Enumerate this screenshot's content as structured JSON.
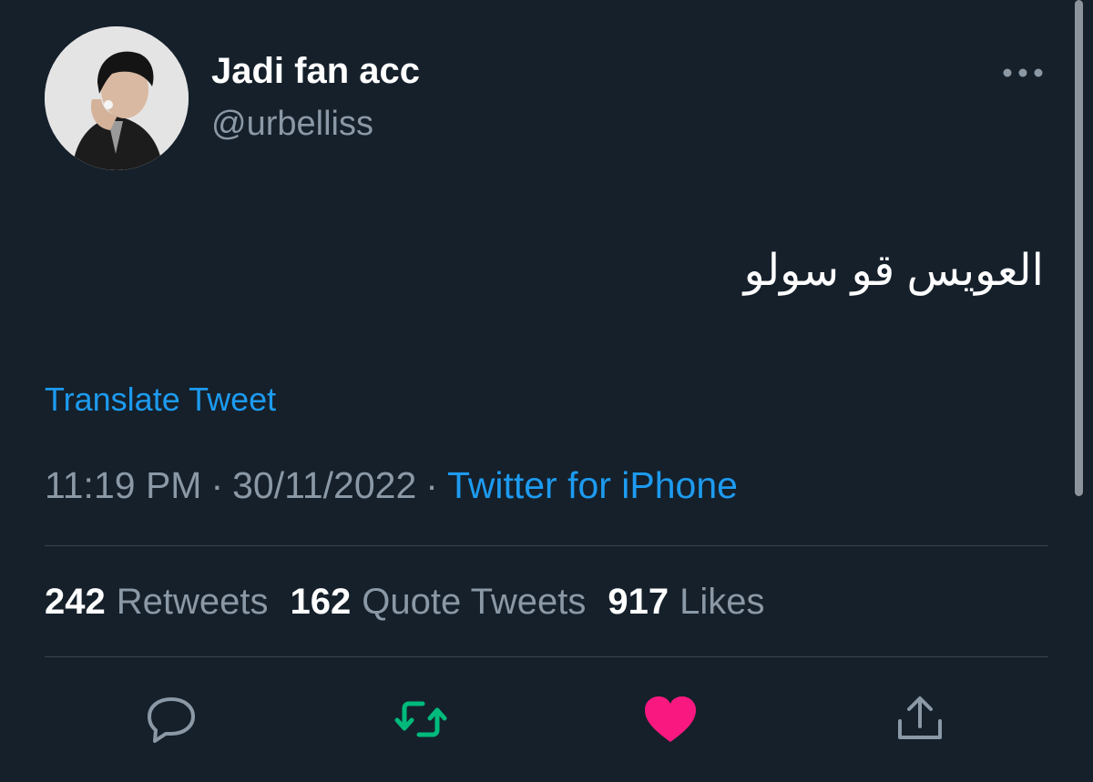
{
  "user": {
    "display_name": "Jadi fan acc",
    "handle": "@urbelliss",
    "avatar_icon": "profile-photo"
  },
  "tweet": {
    "text": "العويس قو سولو",
    "translate_label": "Translate Tweet",
    "time": "11:19 PM",
    "separator": "·",
    "date": "30/11/2022",
    "source": "Twitter for iPhone"
  },
  "stats": {
    "retweets_count": "242",
    "retweets_label": "Retweets",
    "quotes_count": "162",
    "quotes_label": "Quote Tweets",
    "likes_count": "917",
    "likes_label": "Likes"
  },
  "actions": {
    "reply_icon": "speech-bubble-icon",
    "retweet_icon": "retweet-icon",
    "like_icon": "heart-icon",
    "share_icon": "share-icon"
  },
  "colors": {
    "background": "#15202b",
    "link": "#1d9bf0",
    "secondary_text": "#8b98a5",
    "retweet_active": "#00ba7c",
    "like_active": "#f91880",
    "divider": "#38444d"
  }
}
